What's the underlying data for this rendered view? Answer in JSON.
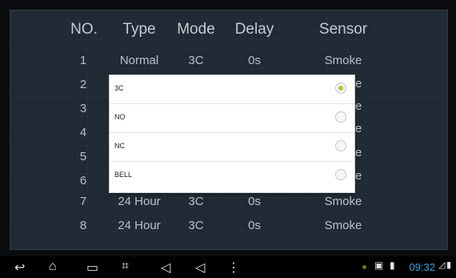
{
  "table": {
    "headers": [
      "NO.",
      "Type",
      "Mode",
      "Delay",
      "Sensor"
    ],
    "rows": [
      [
        "1",
        "Normal",
        "3C",
        "0s",
        "Smoke"
      ],
      [
        "2",
        "",
        "",
        "",
        "e"
      ],
      [
        "3",
        "",
        "",
        "",
        "e"
      ],
      [
        "4",
        "",
        "",
        "",
        "e"
      ],
      [
        "5",
        "",
        "",
        "",
        "e"
      ],
      [
        "6",
        "",
        "",
        "",
        "e"
      ],
      [
        "7",
        "24 Hour",
        "3C",
        "0s",
        "Smoke"
      ],
      [
        "8",
        "24 Hour",
        "3C",
        "0s",
        "Smoke"
      ]
    ]
  },
  "dialog": {
    "options": [
      {
        "label": "3C",
        "selected": true
      },
      {
        "label": "NO",
        "selected": false
      },
      {
        "label": "NC",
        "selected": false
      },
      {
        "label": "BELL",
        "selected": false
      }
    ],
    "accent": "#9ccc3a"
  },
  "status_bar": {
    "time": "09:32",
    "time_color": "#36a3da",
    "icons": [
      "back-icon",
      "home-icon",
      "recent-apps-icon",
      "screenshot-icon",
      "volume-down-icon",
      "volume-up-icon",
      "menu-icon",
      "notification-dot-icon",
      "image-icon",
      "sd-card-icon",
      "signal-icon",
      "battery-icon"
    ]
  }
}
